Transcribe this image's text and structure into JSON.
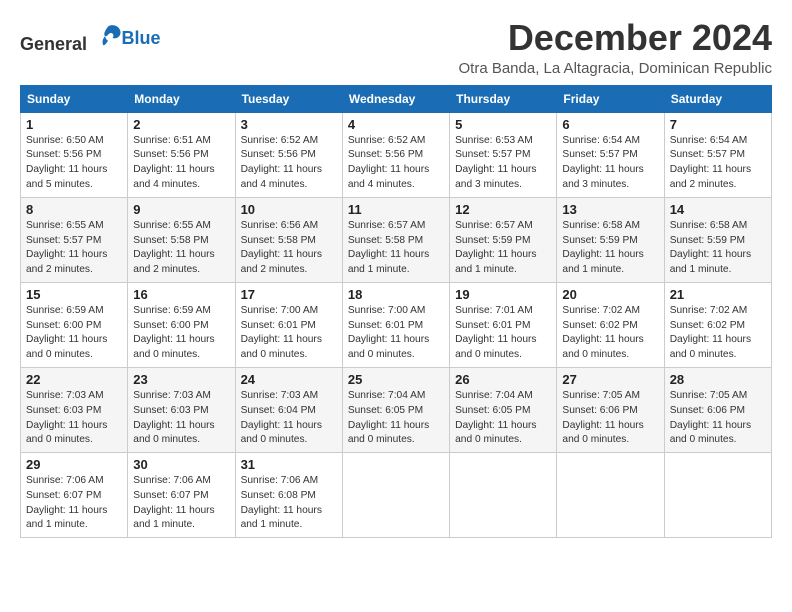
{
  "logo": {
    "text_general": "General",
    "text_blue": "Blue"
  },
  "title": "December 2024",
  "location": "Otra Banda, La Altagracia, Dominican Republic",
  "days_of_week": [
    "Sunday",
    "Monday",
    "Tuesday",
    "Wednesday",
    "Thursday",
    "Friday",
    "Saturday"
  ],
  "weeks": [
    [
      {
        "day": "1",
        "sunrise": "6:50 AM",
        "sunset": "5:56 PM",
        "daylight": "11 hours and 5 minutes."
      },
      {
        "day": "2",
        "sunrise": "6:51 AM",
        "sunset": "5:56 PM",
        "daylight": "11 hours and 4 minutes."
      },
      {
        "day": "3",
        "sunrise": "6:52 AM",
        "sunset": "5:56 PM",
        "daylight": "11 hours and 4 minutes."
      },
      {
        "day": "4",
        "sunrise": "6:52 AM",
        "sunset": "5:56 PM",
        "daylight": "11 hours and 4 minutes."
      },
      {
        "day": "5",
        "sunrise": "6:53 AM",
        "sunset": "5:57 PM",
        "daylight": "11 hours and 3 minutes."
      },
      {
        "day": "6",
        "sunrise": "6:54 AM",
        "sunset": "5:57 PM",
        "daylight": "11 hours and 3 minutes."
      },
      {
        "day": "7",
        "sunrise": "6:54 AM",
        "sunset": "5:57 PM",
        "daylight": "11 hours and 2 minutes."
      }
    ],
    [
      {
        "day": "8",
        "sunrise": "6:55 AM",
        "sunset": "5:57 PM",
        "daylight": "11 hours and 2 minutes."
      },
      {
        "day": "9",
        "sunrise": "6:55 AM",
        "sunset": "5:58 PM",
        "daylight": "11 hours and 2 minutes."
      },
      {
        "day": "10",
        "sunrise": "6:56 AM",
        "sunset": "5:58 PM",
        "daylight": "11 hours and 2 minutes."
      },
      {
        "day": "11",
        "sunrise": "6:57 AM",
        "sunset": "5:58 PM",
        "daylight": "11 hours and 1 minute."
      },
      {
        "day": "12",
        "sunrise": "6:57 AM",
        "sunset": "5:59 PM",
        "daylight": "11 hours and 1 minute."
      },
      {
        "day": "13",
        "sunrise": "6:58 AM",
        "sunset": "5:59 PM",
        "daylight": "11 hours and 1 minute."
      },
      {
        "day": "14",
        "sunrise": "6:58 AM",
        "sunset": "5:59 PM",
        "daylight": "11 hours and 1 minute."
      }
    ],
    [
      {
        "day": "15",
        "sunrise": "6:59 AM",
        "sunset": "6:00 PM",
        "daylight": "11 hours and 0 minutes."
      },
      {
        "day": "16",
        "sunrise": "6:59 AM",
        "sunset": "6:00 PM",
        "daylight": "11 hours and 0 minutes."
      },
      {
        "day": "17",
        "sunrise": "7:00 AM",
        "sunset": "6:01 PM",
        "daylight": "11 hours and 0 minutes."
      },
      {
        "day": "18",
        "sunrise": "7:00 AM",
        "sunset": "6:01 PM",
        "daylight": "11 hours and 0 minutes."
      },
      {
        "day": "19",
        "sunrise": "7:01 AM",
        "sunset": "6:01 PM",
        "daylight": "11 hours and 0 minutes."
      },
      {
        "day": "20",
        "sunrise": "7:02 AM",
        "sunset": "6:02 PM",
        "daylight": "11 hours and 0 minutes."
      },
      {
        "day": "21",
        "sunrise": "7:02 AM",
        "sunset": "6:02 PM",
        "daylight": "11 hours and 0 minutes."
      }
    ],
    [
      {
        "day": "22",
        "sunrise": "7:03 AM",
        "sunset": "6:03 PM",
        "daylight": "11 hours and 0 minutes."
      },
      {
        "day": "23",
        "sunrise": "7:03 AM",
        "sunset": "6:03 PM",
        "daylight": "11 hours and 0 minutes."
      },
      {
        "day": "24",
        "sunrise": "7:03 AM",
        "sunset": "6:04 PM",
        "daylight": "11 hours and 0 minutes."
      },
      {
        "day": "25",
        "sunrise": "7:04 AM",
        "sunset": "6:05 PM",
        "daylight": "11 hours and 0 minutes."
      },
      {
        "day": "26",
        "sunrise": "7:04 AM",
        "sunset": "6:05 PM",
        "daylight": "11 hours and 0 minutes."
      },
      {
        "day": "27",
        "sunrise": "7:05 AM",
        "sunset": "6:06 PM",
        "daylight": "11 hours and 0 minutes."
      },
      {
        "day": "28",
        "sunrise": "7:05 AM",
        "sunset": "6:06 PM",
        "daylight": "11 hours and 0 minutes."
      }
    ],
    [
      {
        "day": "29",
        "sunrise": "7:06 AM",
        "sunset": "6:07 PM",
        "daylight": "11 hours and 1 minute."
      },
      {
        "day": "30",
        "sunrise": "7:06 AM",
        "sunset": "6:07 PM",
        "daylight": "11 hours and 1 minute."
      },
      {
        "day": "31",
        "sunrise": "7:06 AM",
        "sunset": "6:08 PM",
        "daylight": "11 hours and 1 minute."
      },
      null,
      null,
      null,
      null
    ]
  ]
}
